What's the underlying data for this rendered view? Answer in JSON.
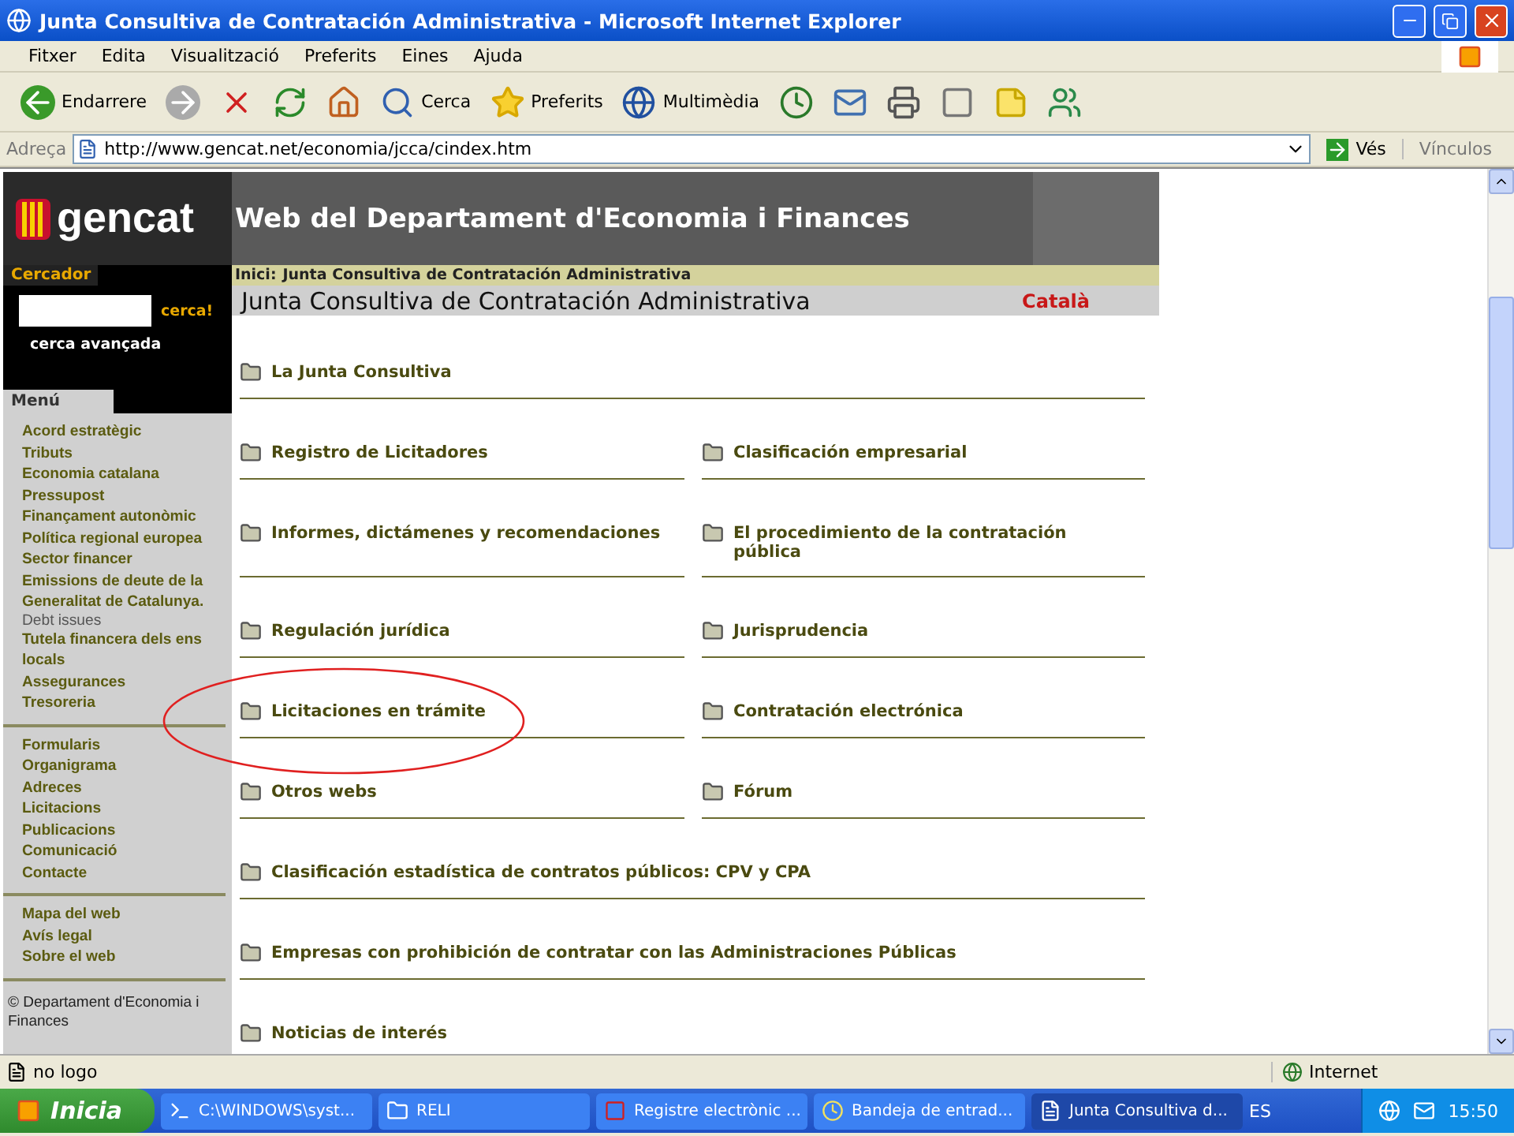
{
  "window": {
    "title": "Junta Consultiva de Contratación Administrativa - Microsoft Internet Explorer"
  },
  "menu_bar": [
    "Fitxer",
    "Edita",
    "Visualització",
    "Preferits",
    "Eines",
    "Ajuda"
  ],
  "toolbar": [
    {
      "kind": "back",
      "label": "Endarrere"
    },
    {
      "kind": "forward"
    },
    {
      "kind": "stop"
    },
    {
      "kind": "refresh"
    },
    {
      "kind": "home"
    },
    {
      "kind": "search",
      "label": "Cerca"
    },
    {
      "kind": "favorites",
      "label": "Preferits"
    },
    {
      "kind": "media",
      "label": "Multimèdia"
    },
    {
      "kind": "history"
    },
    {
      "kind": "mail"
    },
    {
      "kind": "print"
    },
    {
      "kind": "edit"
    },
    {
      "kind": "note"
    },
    {
      "kind": "messenger"
    }
  ],
  "address_bar": {
    "label": "Adreça",
    "url": "http://www.gencat.net/economia/jcca/cindex.htm",
    "go": "Vés",
    "links": "Vínculos"
  },
  "site": {
    "logo": "gencat",
    "header": "Web del Departament d'Economia i Finances",
    "breadcrumb_label": "Inici:",
    "breadcrumb": "Junta Consultiva de Contratación Administrativa",
    "page_title": "Junta Consultiva de Contratación Administrativa",
    "language": "Català"
  },
  "search": {
    "label": "Cercador",
    "button": "cerca!",
    "advanced": "cerca avançada"
  },
  "menu": {
    "title": "Menú",
    "groups": [
      [
        {
          "label": "Acord estratègic"
        },
        {
          "label": "Tributs"
        },
        {
          "label": "Economia catalana"
        },
        {
          "label": "Pressupost"
        },
        {
          "label": "Finançament autonòmic"
        },
        {
          "label": "Política regional europea"
        },
        {
          "label": "Sector financer"
        },
        {
          "label": "Emissions de deute de la Generalitat de Catalunya.",
          "note": "Debt issues"
        },
        {
          "label": "Tutela financera dels ens locals"
        },
        {
          "label": "Assegurances"
        },
        {
          "label": "Tresoreria"
        }
      ],
      [
        {
          "label": "Formularis"
        },
        {
          "label": "Organigrama"
        },
        {
          "label": "Adreces"
        },
        {
          "label": "Licitacions"
        },
        {
          "label": "Publicacions"
        },
        {
          "label": "Comunicació"
        },
        {
          "label": "Contacte"
        }
      ],
      [
        {
          "label": "Mapa del web"
        },
        {
          "label": "Avís legal"
        },
        {
          "label": "Sobre el web"
        }
      ]
    ],
    "footer": "© Departament d'Economia i Finances"
  },
  "links": [
    {
      "label": "La Junta Consultiva",
      "kind": "full"
    },
    {
      "label": "Registro de Licitadores",
      "kind": "half"
    },
    {
      "label": "Clasificación empresarial",
      "kind": "half"
    },
    {
      "label": "Informes, dictámenes y recomendaciones",
      "kind": "half"
    },
    {
      "label": "El procedimiento de la contratación pública",
      "kind": "half"
    },
    {
      "label": "Regulación jurídica",
      "kind": "half"
    },
    {
      "label": "Jurisprudencia",
      "kind": "half"
    },
    {
      "label": "Licitaciones en trámite",
      "kind": "half",
      "circled": true
    },
    {
      "label": "Contratación electrónica",
      "kind": "half"
    },
    {
      "label": "Otros webs",
      "kind": "half"
    },
    {
      "label": "Fórum",
      "kind": "half"
    },
    {
      "label": "Clasificación estadística de contratos públicos: CPV y CPA",
      "kind": "full"
    },
    {
      "label": "Empresas con prohibición de contratar con las Administraciones Públicas",
      "kind": "full"
    },
    {
      "label": "Noticias de interés",
      "kind": "full"
    }
  ],
  "status_bar": {
    "text": "no logo",
    "zone": "Internet"
  },
  "taskbar": {
    "start": "Inicia",
    "tasks": [
      {
        "label": "C:\\WINDOWS\\syst...",
        "kind": "console",
        "selected": false
      },
      {
        "label": "RELI",
        "kind": "folder",
        "selected": false
      },
      {
        "label": "Registre electrònic ...",
        "kind": "app",
        "selected": false
      },
      {
        "label": "Bandeja de entrad...",
        "kind": "mail",
        "selected": false
      },
      {
        "label": "Junta Consultiva d...",
        "kind": "browser",
        "selected": true
      }
    ],
    "language": "ES",
    "clock": "15:50"
  }
}
